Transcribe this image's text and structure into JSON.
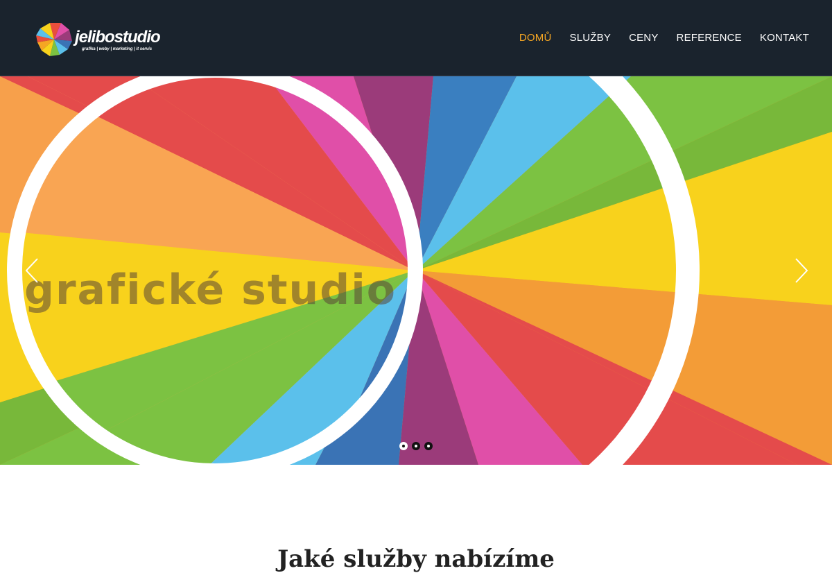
{
  "logo": {
    "wordmark": "jelibostudio",
    "tagline": "grafika | weby | marketing | it servis"
  },
  "nav": {
    "items": [
      {
        "label": "DOMŮ",
        "active": true
      },
      {
        "label": "SLUŽBY",
        "active": false
      },
      {
        "label": "CENY",
        "active": false
      },
      {
        "label": "REFERENCE",
        "active": false
      },
      {
        "label": "KONTAKT",
        "active": false
      }
    ]
  },
  "colors": {
    "header_bg": "#1a232d",
    "nav_active": "#f5a623",
    "nav_text": "#ffffff"
  },
  "hero": {
    "title": "grafické studio",
    "prev_icon": "chevron-left-icon",
    "next_icon": "chevron-right-icon",
    "slides_total": 3,
    "active_slide": 1
  },
  "section": {
    "heading": "Jaké služby nabízíme"
  }
}
